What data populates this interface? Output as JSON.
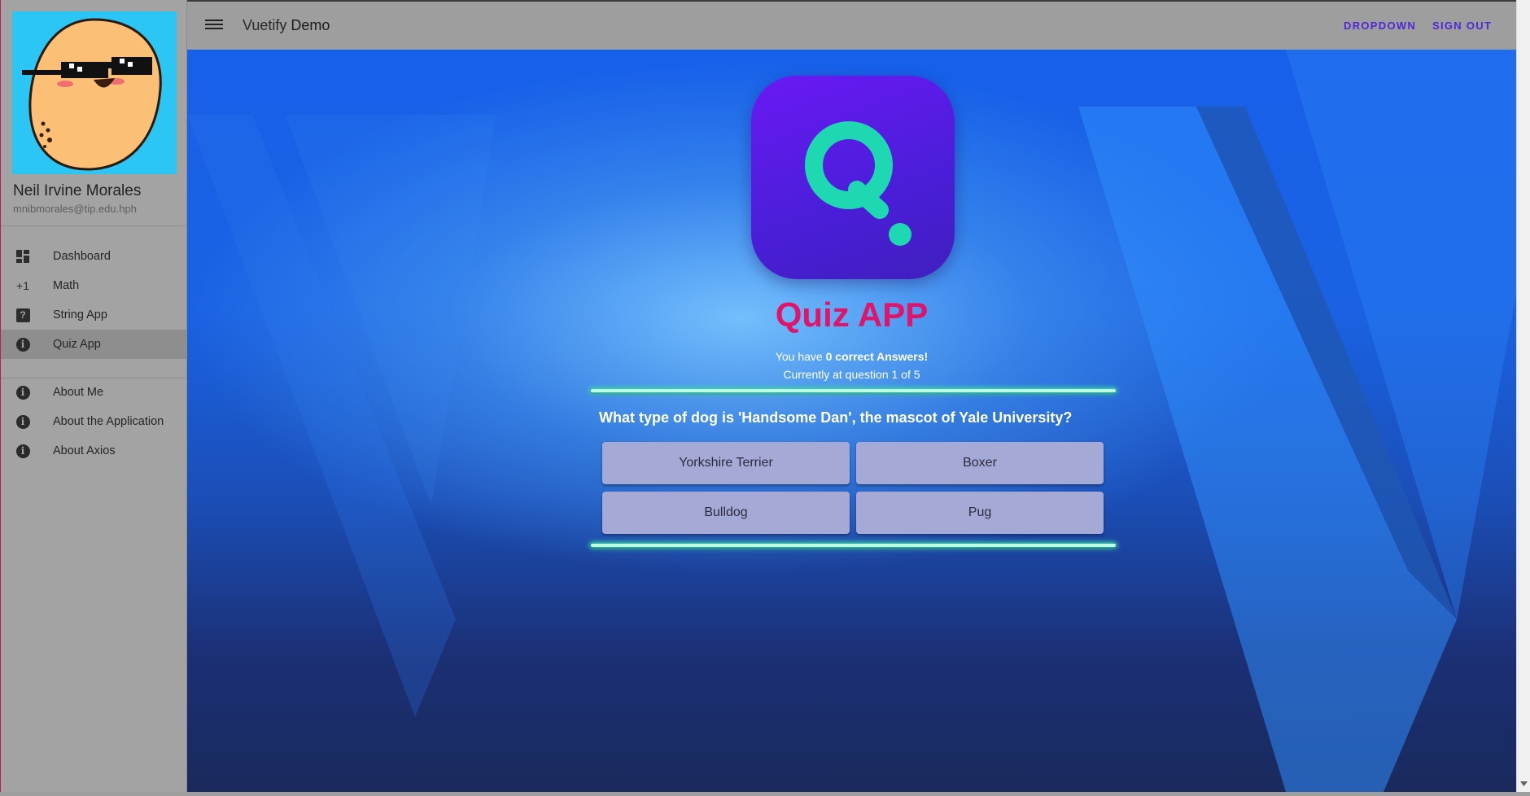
{
  "app_bar": {
    "title_prefix": "Vuetify",
    "title_suffix": "Demo",
    "dropdown_label": "DROPDOWN",
    "signout_label": "SIGN OUT",
    "menu_icon": "menu-icon"
  },
  "sidebar": {
    "user_name": "Neil Irvine Morales",
    "user_email": "mnibmorales@tip.edu.hph",
    "items": [
      {
        "label": "Dashboard",
        "icon": "dashboard-icon"
      },
      {
        "label": "Math",
        "icon": "plus-one-icon",
        "icon_text": "+1"
      },
      {
        "label": "String App",
        "icon": "help-icon",
        "icon_text": "?"
      },
      {
        "label": "Quiz App",
        "icon": "info-icon",
        "icon_text": "i",
        "active": true
      }
    ],
    "about_items": [
      {
        "label": "About Me",
        "icon": "info-icon",
        "icon_text": "i"
      },
      {
        "label": "About the Application",
        "icon": "info-icon",
        "icon_text": "i"
      },
      {
        "label": "About Axios",
        "icon": "info-icon",
        "icon_text": "i"
      }
    ]
  },
  "quiz": {
    "title": "Quiz APP",
    "status_prefix": "You have ",
    "correct_count": "0 correct Answers!",
    "progress_text": "Currently at question 1 of 5",
    "question": "What type of dog is 'Handsome Dan', the mascot of Yale University?",
    "answers": [
      "Yorkshire Terrier",
      "Boxer",
      "Bulldog",
      "Pug"
    ]
  },
  "colors": {
    "accent": "#4f27d9",
    "title": "#e2146a",
    "logo_bg": "#5a1be6",
    "logo_q": "#1ed8b2"
  }
}
